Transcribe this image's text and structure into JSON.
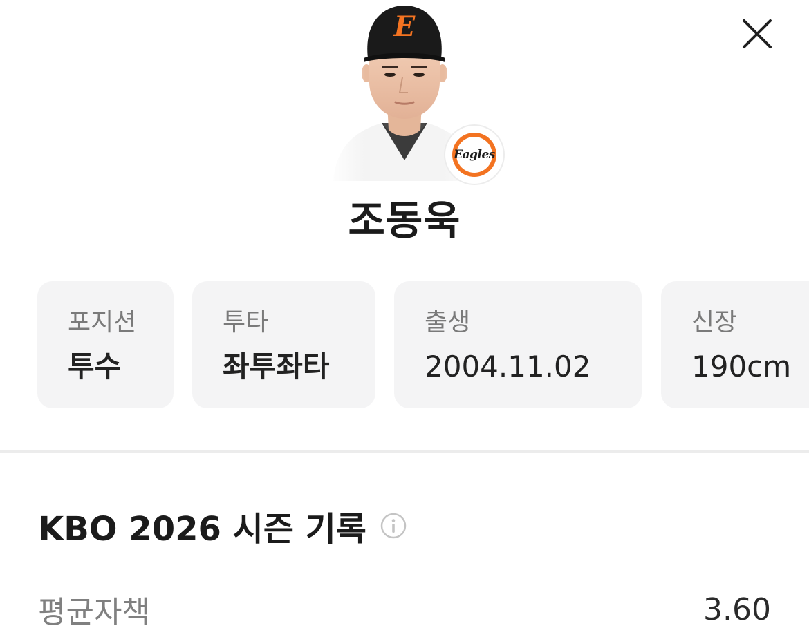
{
  "header": {
    "close_icon": "close-icon"
  },
  "player": {
    "name": "조동욱",
    "cap_letter": "E",
    "team_logo_text": "Eagles",
    "colors": {
      "team_orange": "#f37321",
      "cap_black": "#1a1a1a"
    }
  },
  "info_cards": [
    {
      "label": "포지션",
      "value": "투수"
    },
    {
      "label": "투타",
      "value": "좌투좌타"
    },
    {
      "label": "출생",
      "value": "2004.11.02"
    },
    {
      "label": "신장",
      "value": "190cm"
    }
  ],
  "season": {
    "title": "KBO 2026 시즌 기록",
    "info_icon": "info-icon",
    "stats": [
      {
        "label": "평균자책",
        "value": "3.60"
      }
    ]
  }
}
